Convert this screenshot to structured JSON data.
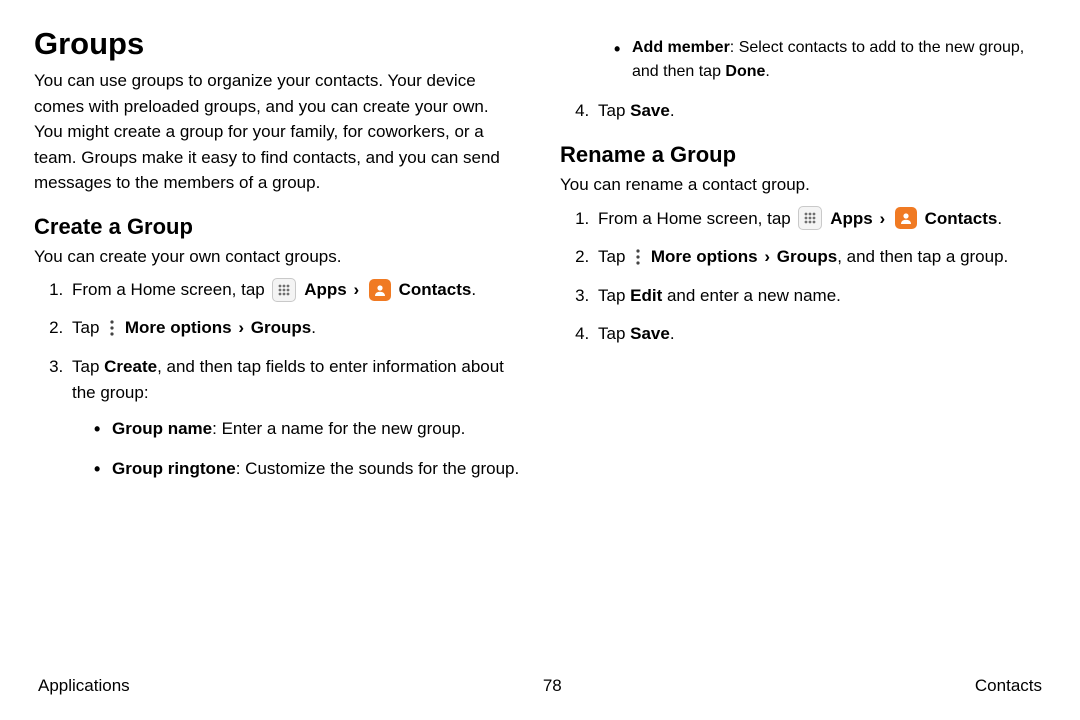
{
  "h1": "Groups",
  "intro": "You can use groups to organize your contacts. Your device comes with preloaded groups, and you can create your own. You might create a group for your family, for coworkers, or a team. Groups make it easy to find contacts, and you can send messages to the members of a group.",
  "create": {
    "heading": "Create a Group",
    "lead": "You can create your own contact groups.",
    "step1_a": "From a Home screen, tap ",
    "apps": "Apps",
    "contacts": "Contacts",
    "period": ".",
    "step2_a": "Tap ",
    "more_options": "More options",
    "groups": "Groups",
    "step3_a": "Tap ",
    "create_word": "Create",
    "step3_b": ", and then tap fields to enter information about the group:",
    "bullet1_label": "Group name",
    "bullet1_text": ": Enter a name for the new group.",
    "bullet2_label": "Group ringtone",
    "bullet2_text": ": Customize the sounds for the group.",
    "bullet3_label": "Add member",
    "bullet3_text_a": ": Select contacts to add to the new group, and then tap ",
    "done": "Done",
    "step4_a": "Tap ",
    "save": "Save"
  },
  "rename": {
    "heading": "Rename a Group",
    "lead": "You can rename a contact group.",
    "step2_b": ", and then tap a group.",
    "step3_a": "Tap ",
    "edit": "Edit",
    "step3_b": " and enter a new name."
  },
  "footer": {
    "left": "Applications",
    "page": "78",
    "right": "Contacts"
  },
  "chev": "›"
}
